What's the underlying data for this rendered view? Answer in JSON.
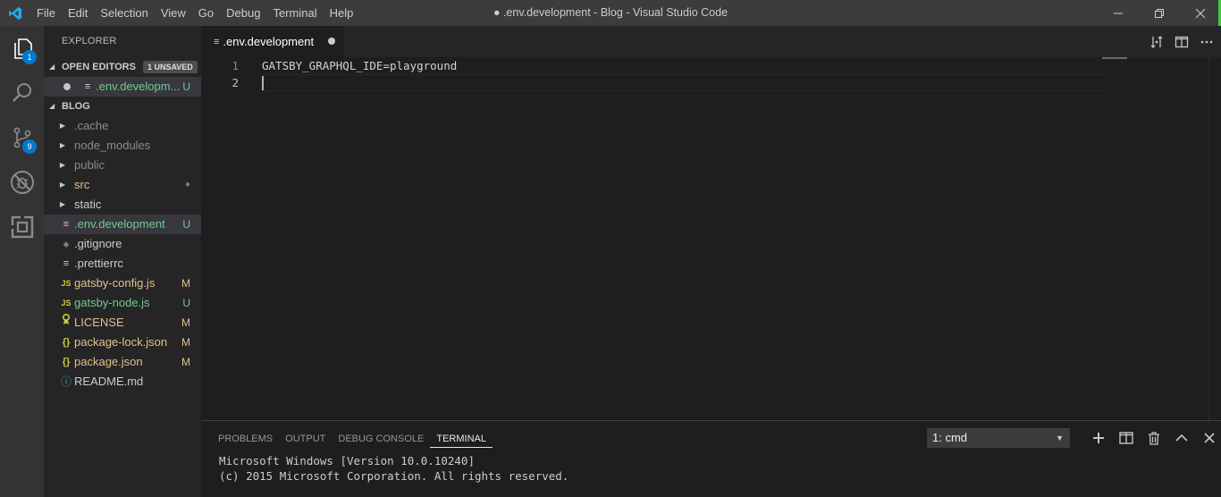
{
  "titlebar": {
    "menu": [
      "File",
      "Edit",
      "Selection",
      "View",
      "Go",
      "Debug",
      "Terminal",
      "Help"
    ],
    "window_title": "● .env.development - Blog - Visual Studio Code"
  },
  "activitybar": {
    "items": [
      {
        "icon": "files-icon",
        "badge": "1"
      },
      {
        "icon": "search-icon",
        "badge": ""
      },
      {
        "icon": "source-control-icon",
        "badge": "9"
      },
      {
        "icon": "debug-icon",
        "badge": ""
      },
      {
        "icon": "extensions-icon",
        "badge": ""
      }
    ]
  },
  "sidebar": {
    "title": "EXPLORER",
    "open_editors": {
      "label": "OPEN EDITORS",
      "badge": "1 UNSAVED",
      "items": [
        {
          "name": ".env.developm...",
          "status": "U"
        }
      ]
    },
    "folder": {
      "label": "BLOG",
      "items": [
        {
          "name": ".cache",
          "kind": "folder",
          "status": ""
        },
        {
          "name": "node_modules",
          "kind": "folder",
          "status": ""
        },
        {
          "name": "public",
          "kind": "folder",
          "status": ""
        },
        {
          "name": "src",
          "kind": "folder",
          "status": "●"
        },
        {
          "name": "static",
          "kind": "folder",
          "status": ""
        },
        {
          "name": ".env.development",
          "kind": "file",
          "icon": "≡",
          "status": "U"
        },
        {
          "name": ".gitignore",
          "kind": "file",
          "icon": "◆",
          "status": ""
        },
        {
          "name": ".prettierrc",
          "kind": "file",
          "icon": "≡",
          "status": ""
        },
        {
          "name": "gatsby-config.js",
          "kind": "file",
          "icon": "JS",
          "status": "M"
        },
        {
          "name": "gatsby-node.js",
          "kind": "file",
          "icon": "JS",
          "status": "U"
        },
        {
          "name": "LICENSE",
          "kind": "file",
          "icon": "license",
          "status": "M"
        },
        {
          "name": "package-lock.json",
          "kind": "file",
          "icon": "{}",
          "status": "M"
        },
        {
          "name": "package.json",
          "kind": "file",
          "icon": "{}",
          "status": "M"
        },
        {
          "name": "README.md",
          "kind": "file",
          "icon": "ⓘ",
          "status": ""
        }
      ]
    }
  },
  "editor": {
    "tab_label": ".env.development",
    "lines": [
      {
        "number": "1",
        "text": "GATSBY_GRAPHQL_IDE=playground"
      },
      {
        "number": "2",
        "text": ""
      }
    ]
  },
  "panel": {
    "tabs": [
      "PROBLEMS",
      "OUTPUT",
      "DEBUG CONSOLE",
      "TERMINAL"
    ],
    "active_tab": "TERMINAL",
    "terminal_select": "1: cmd",
    "terminal_lines": [
      "Microsoft Windows [Version 10.0.10240]",
      "(c) 2015 Microsoft Corporation. All rights reserved."
    ]
  },
  "colors": {
    "accent": "#007acc",
    "untracked": "#73c991",
    "modified": "#e2c08d",
    "js_icon": "#cbcb41",
    "json_icon": "#cbcb41",
    "info_icon": "#519aba"
  }
}
